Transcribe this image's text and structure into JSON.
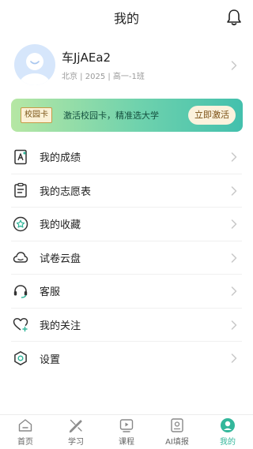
{
  "header": {
    "title": "我的"
  },
  "profile": {
    "name": "车JjAEa2",
    "meta": "北京 | 2025 | 高一-1班"
  },
  "banner": {
    "badge": "校园卡",
    "text": "激活校园卡，精准选大学",
    "button": "立即激活"
  },
  "menu": [
    {
      "label": "我的成绩",
      "icon": "grade-icon"
    },
    {
      "label": "我的志愿表",
      "icon": "list-icon"
    },
    {
      "label": "我的收藏",
      "icon": "star-icon"
    },
    {
      "label": "试卷云盘",
      "icon": "cloud-icon"
    },
    {
      "label": "客服",
      "icon": "headset-icon"
    },
    {
      "label": "我的关注",
      "icon": "heart-icon"
    },
    {
      "label": "设置",
      "icon": "settings-icon"
    }
  ],
  "tabs": [
    {
      "label": "首页",
      "icon": "home-icon"
    },
    {
      "label": "学习",
      "icon": "study-icon"
    },
    {
      "label": "课程",
      "icon": "course-icon"
    },
    {
      "label": "AI填报",
      "icon": "ai-fill-icon"
    },
    {
      "label": "我的",
      "icon": "profile-icon",
      "active": true
    }
  ],
  "colors": {
    "accent": "#33b79b",
    "icon": "#333333",
    "chevron": "#c8c8c8"
  }
}
